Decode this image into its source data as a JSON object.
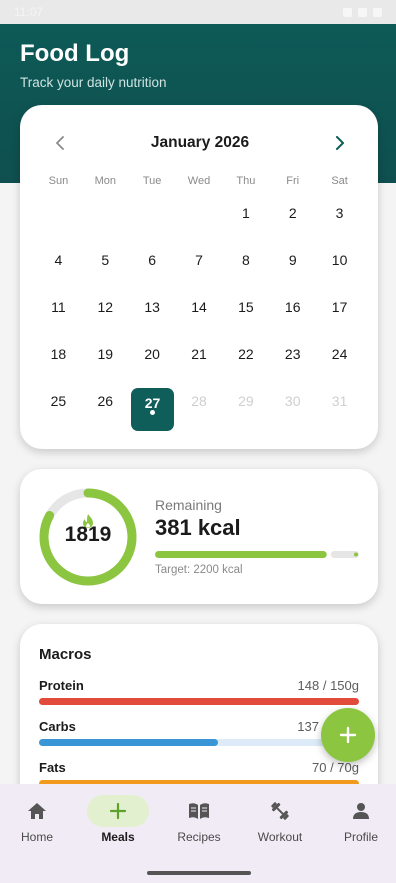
{
  "status_bar": {
    "time": "11:07"
  },
  "header": {
    "title": "Food Log",
    "subtitle": "Track your daily nutrition"
  },
  "calendar": {
    "month_label": "January 2026",
    "weekdays": [
      "Sun",
      "Mon",
      "Tue",
      "Wed",
      "Thu",
      "Fri",
      "Sat"
    ],
    "weeks": [
      [
        "",
        "",
        "",
        "",
        "1",
        "2",
        "3"
      ],
      [
        "4",
        "5",
        "6",
        "7",
        "8",
        "9",
        "10"
      ],
      [
        "11",
        "12",
        "13",
        "14",
        "15",
        "16",
        "17"
      ],
      [
        "18",
        "19",
        "20",
        "21",
        "22",
        "23",
        "24"
      ],
      [
        "25",
        "26",
        "27",
        "28",
        "29",
        "30",
        "31"
      ]
    ],
    "selected_day": "27",
    "future_days": [
      "28",
      "29",
      "30",
      "31"
    ]
  },
  "calories": {
    "consumed": "1819",
    "remaining_label": "Remaining",
    "remaining_value": "381 kcal",
    "target_text": "Target: 2200 kcal",
    "progress_fraction": 0.83
  },
  "macros": {
    "title": "Macros",
    "items": [
      {
        "name": "Protein",
        "value": "148 / 150g",
        "fraction": 1.0,
        "color": "#e24b3b"
      },
      {
        "name": "Carbs",
        "value": "137",
        "fraction": 0.56,
        "color": "#3a95d6"
      },
      {
        "name": "Fats",
        "value": "70 / 70g",
        "fraction": 1.0,
        "color": "#f29a1e"
      }
    ]
  },
  "fab": {
    "icon": "plus-icon"
  },
  "bottom_nav": {
    "items": [
      {
        "label": "Home",
        "icon": "home-icon"
      },
      {
        "label": "Meals",
        "icon": "plus-icon"
      },
      {
        "label": "Recipes",
        "icon": "book-icon"
      },
      {
        "label": "Workout",
        "icon": "dumbbell-icon"
      },
      {
        "label": "Profile",
        "icon": "person-icon"
      }
    ],
    "active": "Meals"
  },
  "colors": {
    "primary": "#0f5e5a",
    "accent_green": "#8cc540",
    "protein": "#e24b3b",
    "carbs": "#3a95d6",
    "fats": "#f29a1e"
  }
}
